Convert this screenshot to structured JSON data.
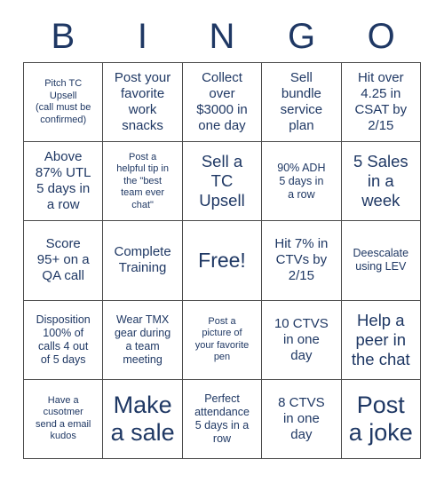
{
  "title": "BINGO",
  "colors": {
    "text": "#1F3864",
    "border": "#4A4A4A",
    "background": "#FFFFFF"
  },
  "header": {
    "letters": [
      "B",
      "I",
      "N",
      "G",
      "O"
    ]
  },
  "grid": {
    "rows": 5,
    "columns": 5,
    "cells": [
      {
        "text": "Pitch TC\nUpsell\n(call must be\nconfirmed)",
        "size": "xs",
        "free": false
      },
      {
        "text": "Post your\nfavorite\nwork\nsnacks",
        "size": "m",
        "free": false
      },
      {
        "text": "Collect\nover\n$3000 in\none day",
        "size": "m",
        "free": false
      },
      {
        "text": "Sell\nbundle\nservice\nplan",
        "size": "m",
        "free": false
      },
      {
        "text": "Hit over\n4.25 in\nCSAT by\n2/15",
        "size": "m",
        "free": false
      },
      {
        "text": "Above\n87% UTL\n5 days in\na row",
        "size": "m",
        "free": false
      },
      {
        "text": "Post a\nhelpful tip in\nthe \"best\nteam ever\nchat\"",
        "size": "xs",
        "free": false
      },
      {
        "text": "Sell a\nTC\nUpsell",
        "size": "l",
        "free": false
      },
      {
        "text": "90% ADH\n5 days in\na row",
        "size": "s",
        "free": false
      },
      {
        "text": "5 Sales\nin a\nweek",
        "size": "l",
        "free": false
      },
      {
        "text": "Score\n95+ on a\nQA call",
        "size": "m",
        "free": false
      },
      {
        "text": "Complete\nTraining",
        "size": "m",
        "free": false
      },
      {
        "text": "Free!",
        "size": "xl",
        "free": true
      },
      {
        "text": "Hit 7% in\nCTVs by\n2/15",
        "size": "m",
        "free": false
      },
      {
        "text": "Deescalate\nusing LEV",
        "size": "s",
        "free": false
      },
      {
        "text": "Disposition\n100% of\ncalls 4 out\nof 5 days",
        "size": "s",
        "free": false
      },
      {
        "text": "Wear TMX\ngear during\na team\nmeeting",
        "size": "s",
        "free": false
      },
      {
        "text": "Post a\npicture of\nyour favorite\npen",
        "size": "xs",
        "free": false
      },
      {
        "text": "10 CTVS\nin one\nday",
        "size": "m",
        "free": false
      },
      {
        "text": "Help a\npeer in\nthe chat",
        "size": "l",
        "free": false
      },
      {
        "text": "Have a\ncusotmer\nsend a email\nkudos",
        "size": "xs",
        "free": false
      },
      {
        "text": "Make\na sale",
        "size": "xxl",
        "free": false
      },
      {
        "text": "Perfect\nattendance\n5 days in a\nrow",
        "size": "s",
        "free": false
      },
      {
        "text": "8 CTVS\nin one\nday",
        "size": "m",
        "free": false
      },
      {
        "text": "Post\na joke",
        "size": "xxl",
        "free": false
      }
    ]
  }
}
